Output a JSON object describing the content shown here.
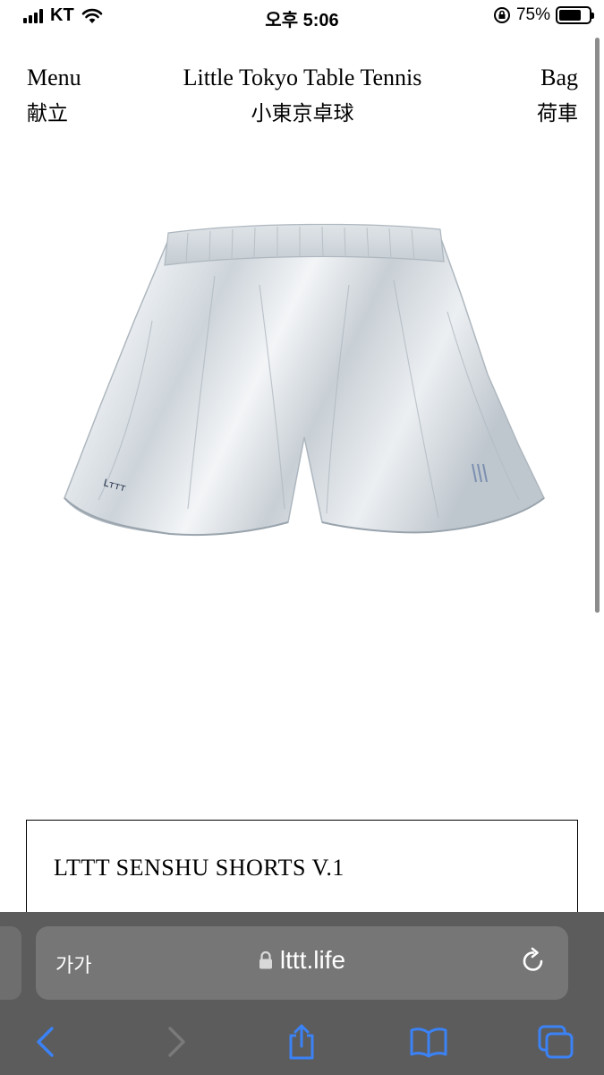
{
  "status_bar": {
    "carrier": "KT",
    "time": "오후 5:06",
    "battery_percent": "75%",
    "battery_level": 0.75
  },
  "header": {
    "menu_en": "Menu",
    "menu_jp": "献立",
    "title_en": "Little Tokyo Table Tennis",
    "title_jp": "小東京卓球",
    "bag_en": "Bag",
    "bag_jp": "荷車"
  },
  "product": {
    "image_alt": "LTTT Senshu Shorts",
    "name": "LTTT SENSHU SHORTS V.1"
  },
  "browser": {
    "text_size_label": "가가",
    "url": "lttt.life",
    "icons": [
      "lock-icon",
      "reload-icon",
      "back-icon",
      "forward-icon",
      "share-icon",
      "bookmarks-icon",
      "tabs-icon"
    ]
  }
}
